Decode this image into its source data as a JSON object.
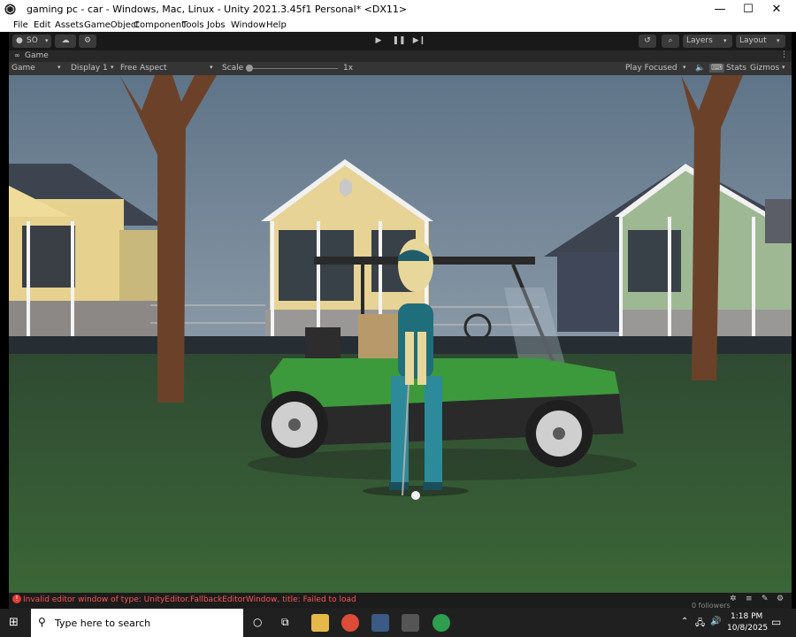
{
  "window": {
    "title": "gaming pc - car - Windows, Mac, Linux - Unity 2021.3.45f1 Personal* <DX11>",
    "minimize_glyph": "—",
    "maximize_glyph": "☐",
    "close_glyph": "✕"
  },
  "menu": [
    "File",
    "Edit",
    "Assets",
    "GameObject",
    "Component",
    "Tools",
    "Jobs",
    "Window",
    "Help"
  ],
  "toolbar": {
    "account_label": "SO",
    "layers_label": "Layers",
    "layout_label": "Layout"
  },
  "game_tab": {
    "label": "Game"
  },
  "game_toolbar": {
    "view_select": "Game",
    "display_select": "Display 1",
    "aspect_select": "Free Aspect",
    "scale_label": "Scale",
    "scale_value": "1x",
    "play_mode": "Play Focused",
    "stats_label": "Stats",
    "gizmos_label": "Gizmos"
  },
  "status": {
    "error_message": "Invalid editor window of type: UnityEditor.FallbackEditorWindow, title: Failed to load",
    "overlay_text": "0 followers"
  },
  "taskbar": {
    "search_placeholder": "Type here to search",
    "time": "1:18 PM",
    "date": "10/8/2025"
  }
}
